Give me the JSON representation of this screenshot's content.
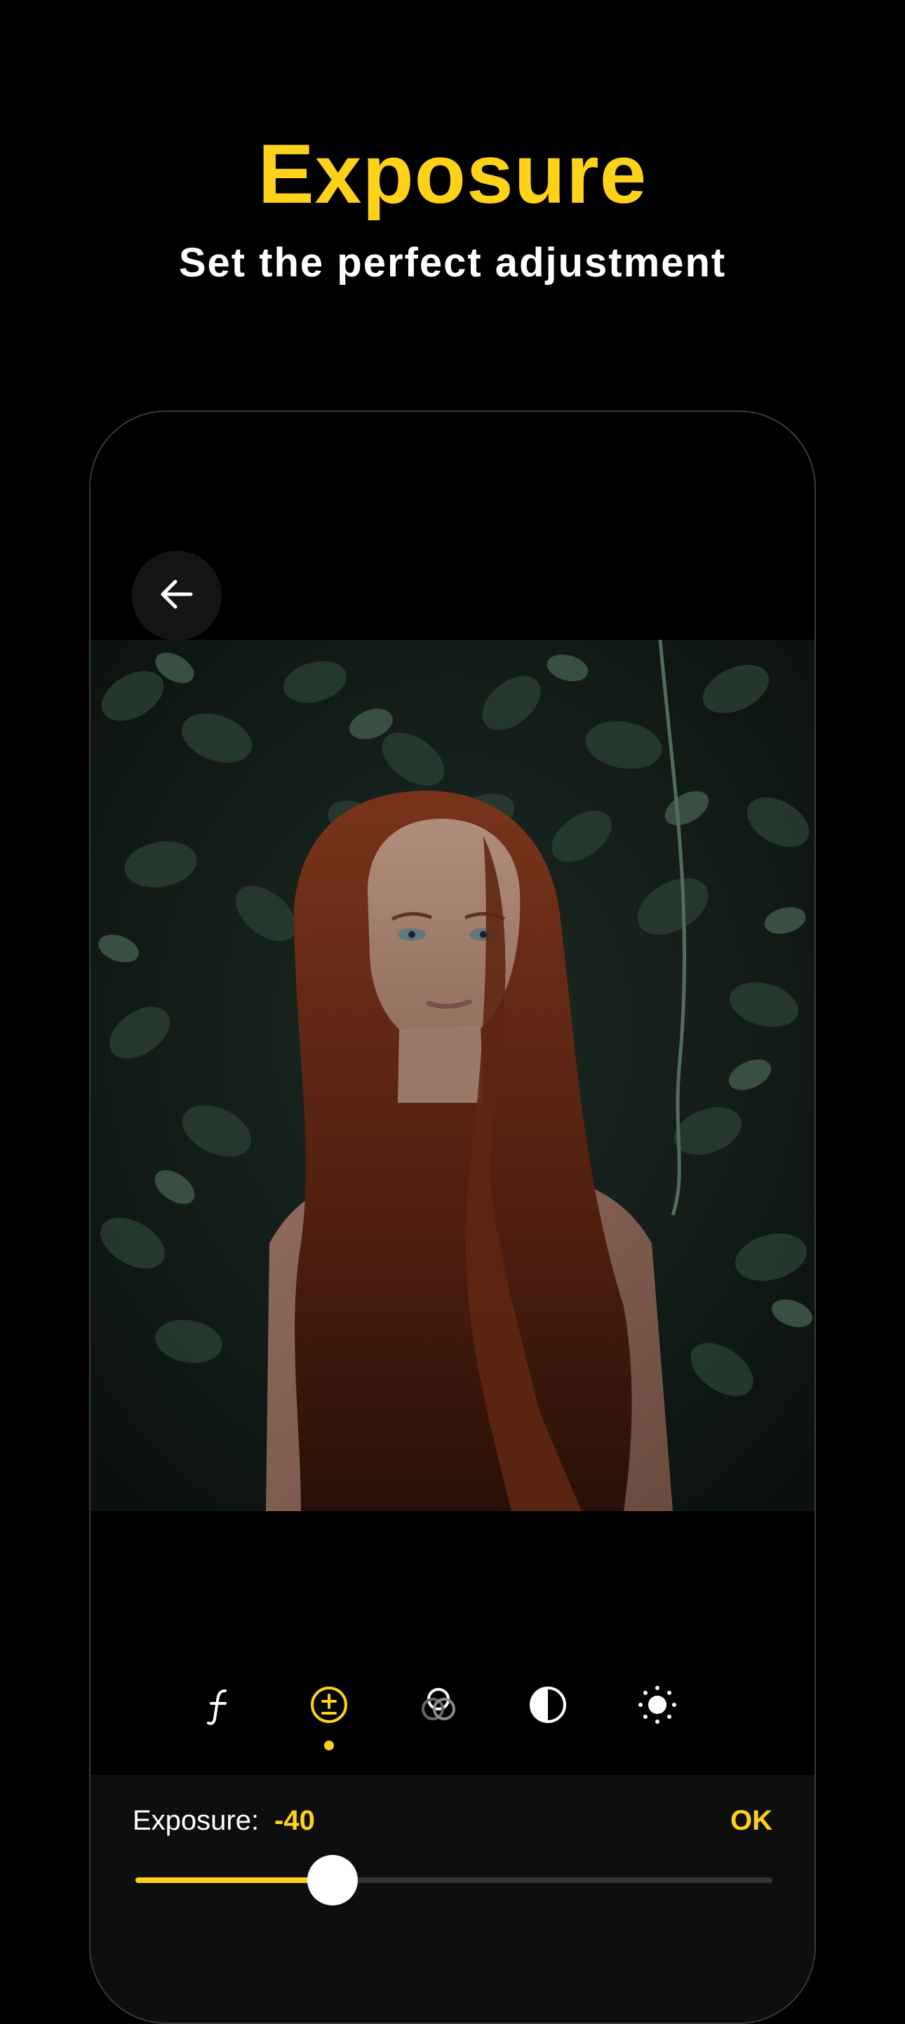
{
  "promo": {
    "title": "Exposure",
    "subtitle": "Set the perfect adjustment"
  },
  "colors": {
    "accent": "#FFD21A",
    "background": "#000000",
    "panel": "#0E0E0E",
    "track": "#333333"
  },
  "navigation": {
    "back_icon": "arrow-left-icon"
  },
  "photo": {
    "icon": "portrait-photo"
  },
  "tools": [
    {
      "icon": "aperture-f-icon",
      "active": false
    },
    {
      "icon": "exposure-plus-minus-icon",
      "active": true
    },
    {
      "icon": "color-mix-circles-icon",
      "active": false
    },
    {
      "icon": "contrast-half-circle-icon",
      "active": false
    },
    {
      "icon": "brightness-sun-icon",
      "active": false
    }
  ],
  "adjustment": {
    "label": "Exposure:",
    "value": "-40",
    "ok_label": "OK",
    "slider_fraction": 0.31
  }
}
